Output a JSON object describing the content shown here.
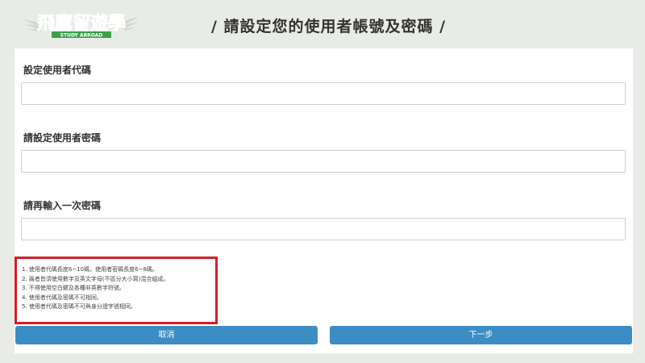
{
  "logo": {
    "text": "飛鷹留遊學",
    "sub_text": "STUDY ABROAD"
  },
  "page_title": "/ 請設定您的使用者帳號及密碼 /",
  "form": {
    "fields": [
      {
        "label": "設定使用者代碼",
        "value": "",
        "placeholder": ""
      },
      {
        "label": "請設定使用者密碼",
        "value": "",
        "placeholder": ""
      },
      {
        "label": "請再輸入一次密碼",
        "value": "",
        "placeholder": ""
      }
    ]
  },
  "rules": [
    "1. 使用者代碼長度6~10碼，使用者密碼長度6~8碼。",
    "2. 兩者皆須使用數字及英文字母(不區分大小寫)混合組成。",
    "3. 不得使用空白鍵及各種非英數字符號。",
    "4. 使用者代碼及密碼不可相同。",
    "5. 使用者代碼及密碼不可與身分證字號相同。"
  ],
  "buttons": {
    "cancel_label": "取消",
    "next_label": "下一步"
  },
  "colors": {
    "background": "#e9ebe6",
    "card": "#ffffff",
    "button": "#3c8dc3",
    "highlight_border": "#d81e28",
    "logo_green": "#3aa04a"
  }
}
